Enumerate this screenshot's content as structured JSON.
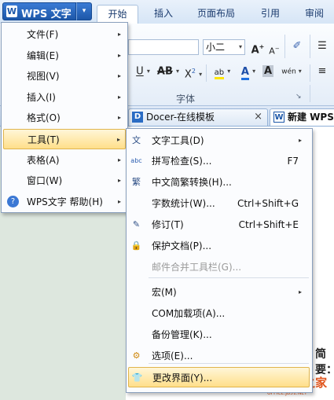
{
  "app": {
    "button_label": "WPS 文字",
    "logo_letter": "W",
    "dropdown_glyph": "▾"
  },
  "ribbon_tabs": [
    "开始",
    "插入",
    "页面布局",
    "引用",
    "审阅"
  ],
  "ribbon": {
    "font_size_value": "小二",
    "grow_font": "A",
    "shrink_font": "A",
    "underline": "U",
    "strikethrough": "AB",
    "superscript": "X",
    "superscript_mark": "2",
    "highlight": "ab",
    "font_color": "A",
    "char_shading": "A",
    "phonetic": "wén",
    "group_label": "字体",
    "launcher": "↘"
  },
  "doc_tabs": [
    {
      "label": "Docer-在线模板",
      "icon": "D",
      "close": "×"
    },
    {
      "label": "新建 WPS",
      "icon": "W"
    }
  ],
  "main_menu": {
    "items": [
      {
        "label": "文件(F)",
        "has_submenu": true
      },
      {
        "label": "编辑(E)",
        "has_submenu": true
      },
      {
        "label": "视图(V)",
        "has_submenu": true
      },
      {
        "label": "插入(I)",
        "has_submenu": true
      },
      {
        "label": "格式(O)",
        "has_submenu": true
      },
      {
        "label": "工具(T)",
        "has_submenu": true,
        "highlighted": true
      },
      {
        "label": "表格(A)",
        "has_submenu": true
      },
      {
        "label": "窗口(W)",
        "has_submenu": true
      },
      {
        "label": "WPS文字 帮助(H)",
        "has_submenu": true,
        "icon": "help-icon"
      }
    ],
    "arrow": "▸",
    "help_glyph": "?"
  },
  "tools_menu": {
    "items": [
      {
        "label": "文字工具(D)",
        "shortcut": "",
        "has_submenu": true,
        "icon": "text-tools-icon",
        "glyph": "文"
      },
      {
        "label": "拼写检查(S)...",
        "shortcut": "F7",
        "icon": "spell-check-icon",
        "glyph": "abc"
      },
      {
        "label": "中文简繁转换(H)...",
        "shortcut": "",
        "icon": "chinese-convert-icon",
        "glyph": "繁"
      },
      {
        "label": "字数统计(W)...",
        "shortcut": "Ctrl+Shift+G",
        "icon": "",
        "glyph": ""
      },
      {
        "label": "修订(T)",
        "shortcut": "Ctrl+Shift+E",
        "icon": "track-changes-icon",
        "glyph": "✎"
      },
      {
        "label": "保护文档(P)...",
        "shortcut": "",
        "icon": "lock-icon",
        "glyph": "🔒"
      },
      {
        "label": "邮件合并工具栏(G)...",
        "shortcut": "",
        "disabled": true
      },
      {
        "label": "宏(M)",
        "shortcut": "",
        "has_submenu": true
      },
      {
        "label": "COM加载项(A)...",
        "shortcut": ""
      },
      {
        "label": "备份管理(K)...",
        "shortcut": ""
      },
      {
        "label": "选项(E)...",
        "shortcut": "",
        "icon": "gear-icon",
        "glyph": "⚙"
      },
      {
        "label": "更改界面(Y)...",
        "shortcut": "",
        "icon": "skin-icon",
        "glyph": "👕",
        "highlighted": true
      }
    ],
    "arrow": "▸"
  },
  "document": {
    "visible_text": "简要："
  },
  "watermark": {
    "line1": "office之家",
    "line2": "OFFICE.JB51.NET"
  },
  "colors": {
    "highlight_bg": "#ffdf8a",
    "brand_blue": "#1d57a8",
    "watermark": "#e0541c"
  }
}
